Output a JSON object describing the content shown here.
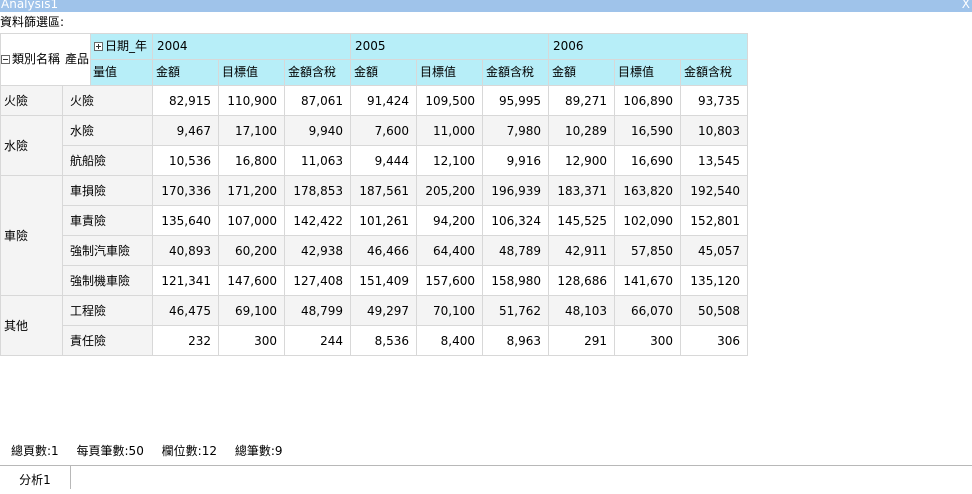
{
  "window": {
    "title": "Analysis1",
    "close_label": "X"
  },
  "filter_area_label": "資料篩選區:",
  "pivot": {
    "row_field_1": "類別名稱",
    "row_field_2": "產品",
    "col_field": "日期_年",
    "measure_label": "量值",
    "years": [
      "2004",
      "2005",
      "2006"
    ],
    "measures": [
      "金額",
      "目標值",
      "金額含稅"
    ],
    "groups": [
      {
        "category": "火險",
        "products": [
          {
            "name": "火險",
            "values": [
              "82,915",
              "110,900",
              "87,061",
              "91,424",
              "109,500",
              "95,995",
              "89,271",
              "106,890",
              "93,735"
            ]
          }
        ]
      },
      {
        "category": "水險",
        "products": [
          {
            "name": "水險",
            "values": [
              "9,467",
              "17,100",
              "9,940",
              "7,600",
              "11,000",
              "7,980",
              "10,289",
              "16,590",
              "10,803"
            ]
          },
          {
            "name": "航船險",
            "values": [
              "10,536",
              "16,800",
              "11,063",
              "9,444",
              "12,100",
              "9,916",
              "12,900",
              "16,690",
              "13,545"
            ]
          }
        ]
      },
      {
        "category": "車險",
        "products": [
          {
            "name": "車損險",
            "values": [
              "170,336",
              "171,200",
              "178,853",
              "187,561",
              "205,200",
              "196,939",
              "183,371",
              "163,820",
              "192,540"
            ]
          },
          {
            "name": "車責險",
            "values": [
              "135,640",
              "107,000",
              "142,422",
              "101,261",
              "94,200",
              "106,324",
              "145,525",
              "102,090",
              "152,801"
            ]
          },
          {
            "name": "強制汽車險",
            "values": [
              "40,893",
              "60,200",
              "42,938",
              "46,466",
              "64,400",
              "48,789",
              "42,911",
              "57,850",
              "45,057"
            ]
          },
          {
            "name": "強制機車險",
            "values": [
              "121,341",
              "147,600",
              "127,408",
              "151,409",
              "157,600",
              "158,980",
              "128,686",
              "141,670",
              "135,120"
            ]
          }
        ]
      },
      {
        "category": "其他",
        "products": [
          {
            "name": "工程險",
            "values": [
              "46,475",
              "69,100",
              "48,799",
              "49,297",
              "70,100",
              "51,762",
              "48,103",
              "66,070",
              "50,508"
            ]
          },
          {
            "name": "責任險",
            "values": [
              "232",
              "300",
              "244",
              "8,536",
              "8,400",
              "8,963",
              "291",
              "300",
              "306"
            ]
          }
        ]
      }
    ]
  },
  "status": {
    "total_pages": "總頁數:1",
    "rows_per_page": "每頁筆數:50",
    "column_count": "欄位數:12",
    "record_count": "總筆數:9"
  },
  "tabs": [
    {
      "label": "分析1"
    }
  ]
}
